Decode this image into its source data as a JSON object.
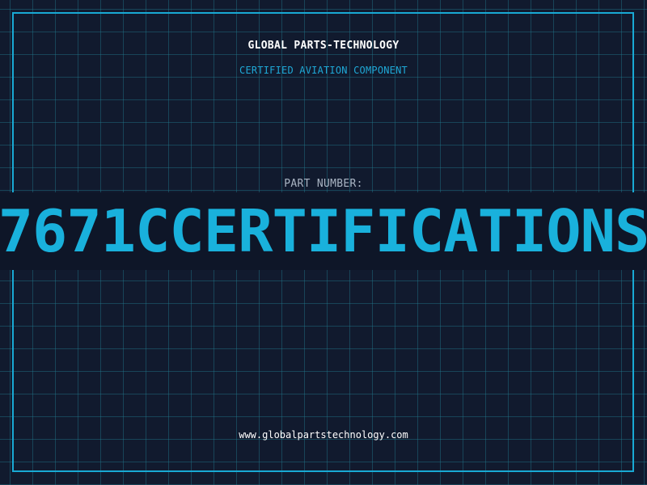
{
  "header": {
    "company": "GLOBAL PARTS-TECHNOLOGY",
    "tagline": "CERTIFIED AVIATION COMPONENT"
  },
  "part": {
    "label": "PART NUMBER:",
    "number": "7671CCERTIFICATIONS"
  },
  "footer": {
    "url": "www.globalpartstechnology.com"
  },
  "colors": {
    "background": "#111a2e",
    "grid": "#22788c",
    "accent": "#19b1dc",
    "text": "#ffffff"
  }
}
